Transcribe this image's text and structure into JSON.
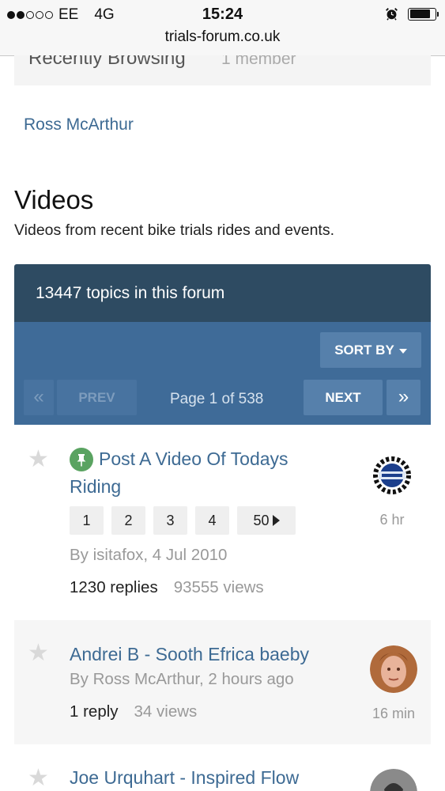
{
  "status_bar": {
    "carrier": "EE",
    "network": "4G",
    "time": "15:24",
    "signal_bars": 2,
    "icons": [
      "alarm-icon",
      "battery-icon"
    ]
  },
  "browser": {
    "url": "trials-forum.co.uk"
  },
  "recently_browsing": {
    "title": "Recently Browsing",
    "count": "1 member",
    "members": [
      "Ross McArthur"
    ]
  },
  "forum": {
    "title": "Videos",
    "description": "Videos from recent bike trials rides and events.",
    "topic_count_text": "13447 topics in this forum"
  },
  "controls": {
    "sort_label": "SORT BY",
    "first_label": "«",
    "prev_label": "PREV",
    "page_info": "Page 1 of 538",
    "next_label": "NEXT",
    "last_label": "»"
  },
  "topics": [
    {
      "title_line1": "Post A Video Of Todays",
      "title_line2": "Riding",
      "pinned": true,
      "pages": [
        "1",
        "2",
        "3",
        "4",
        "50"
      ],
      "meta": "By isitafox, 4 Jul 2010",
      "replies": "1230 replies",
      "views": "93555 views",
      "last_post": "6 hr"
    },
    {
      "title_line1": "Andrei B - Sooth Efrica baeby",
      "pinned": false,
      "meta": "By Ross McArthur, 2 hours ago",
      "replies": "1 reply",
      "views": "34 views",
      "last_post": "16 min"
    },
    {
      "title_line1": "Joe Urquhart - Inspired Flow",
      "pinned": false
    }
  ],
  "colors": {
    "header_dark": "#2e4b62",
    "header_bar": "#3f6b98",
    "button": "#5680ab",
    "link": "#3d6a93",
    "pin_badge": "#5aa361"
  }
}
